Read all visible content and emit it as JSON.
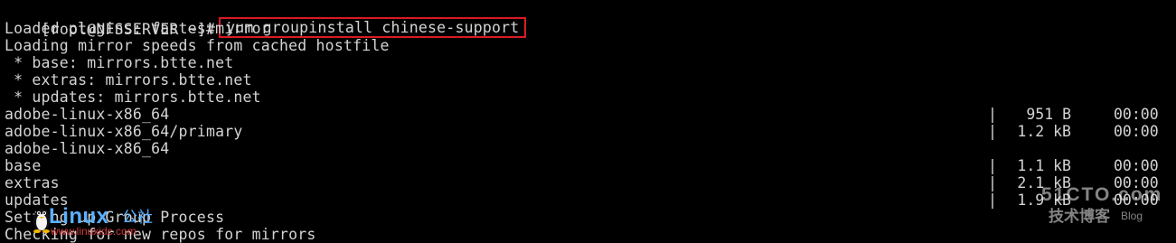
{
  "terminal": {
    "prompt": "[root@NFSSERVER ~]#",
    "command": "yum groupinstall chinese-support",
    "lines": [
      "Loaded plugins: fastestmirror",
      "Loading mirror speeds from cached hostfile",
      " * base: mirrors.btte.net",
      " * extras: mirrors.btte.net",
      " * updates: mirrors.btte.net"
    ],
    "repos": [
      {
        "name": "adobe-linux-x86_64",
        "sep": "|",
        "size": "951 B",
        "time": "00:00"
      },
      {
        "name": "adobe-linux-x86_64/primary",
        "sep": "|",
        "size": "1.2 kB",
        "time": "00:00"
      },
      {
        "name": "adobe-linux-x86_64",
        "sep": "",
        "size": "",
        "time": ""
      },
      {
        "name": "base",
        "sep": "|",
        "size": "1.1 kB",
        "time": "00:00"
      },
      {
        "name": "extras",
        "sep": "|",
        "size": "2.1 kB",
        "time": "00:00"
      },
      {
        "name": "updates",
        "sep": "|",
        "size": "1.9 kB",
        "time": "00:00"
      }
    ],
    "after": [
      "Setting up Group Process",
      "Checking for new repos for mirrors"
    ]
  },
  "watermark_left": {
    "brand": "Linux",
    "brand_cn": "公社",
    "url": "www.linuxidc.com"
  },
  "watermark_right": {
    "brand": "51CTO.com",
    "subtitle": "技术博客",
    "blog": "Blog"
  },
  "colors": {
    "background": "#000000",
    "text": "#d4d4d4",
    "highlight_border": "#d81b24",
    "linux_blue": "#5bb0ff",
    "linux_url_red": "#d63838"
  }
}
